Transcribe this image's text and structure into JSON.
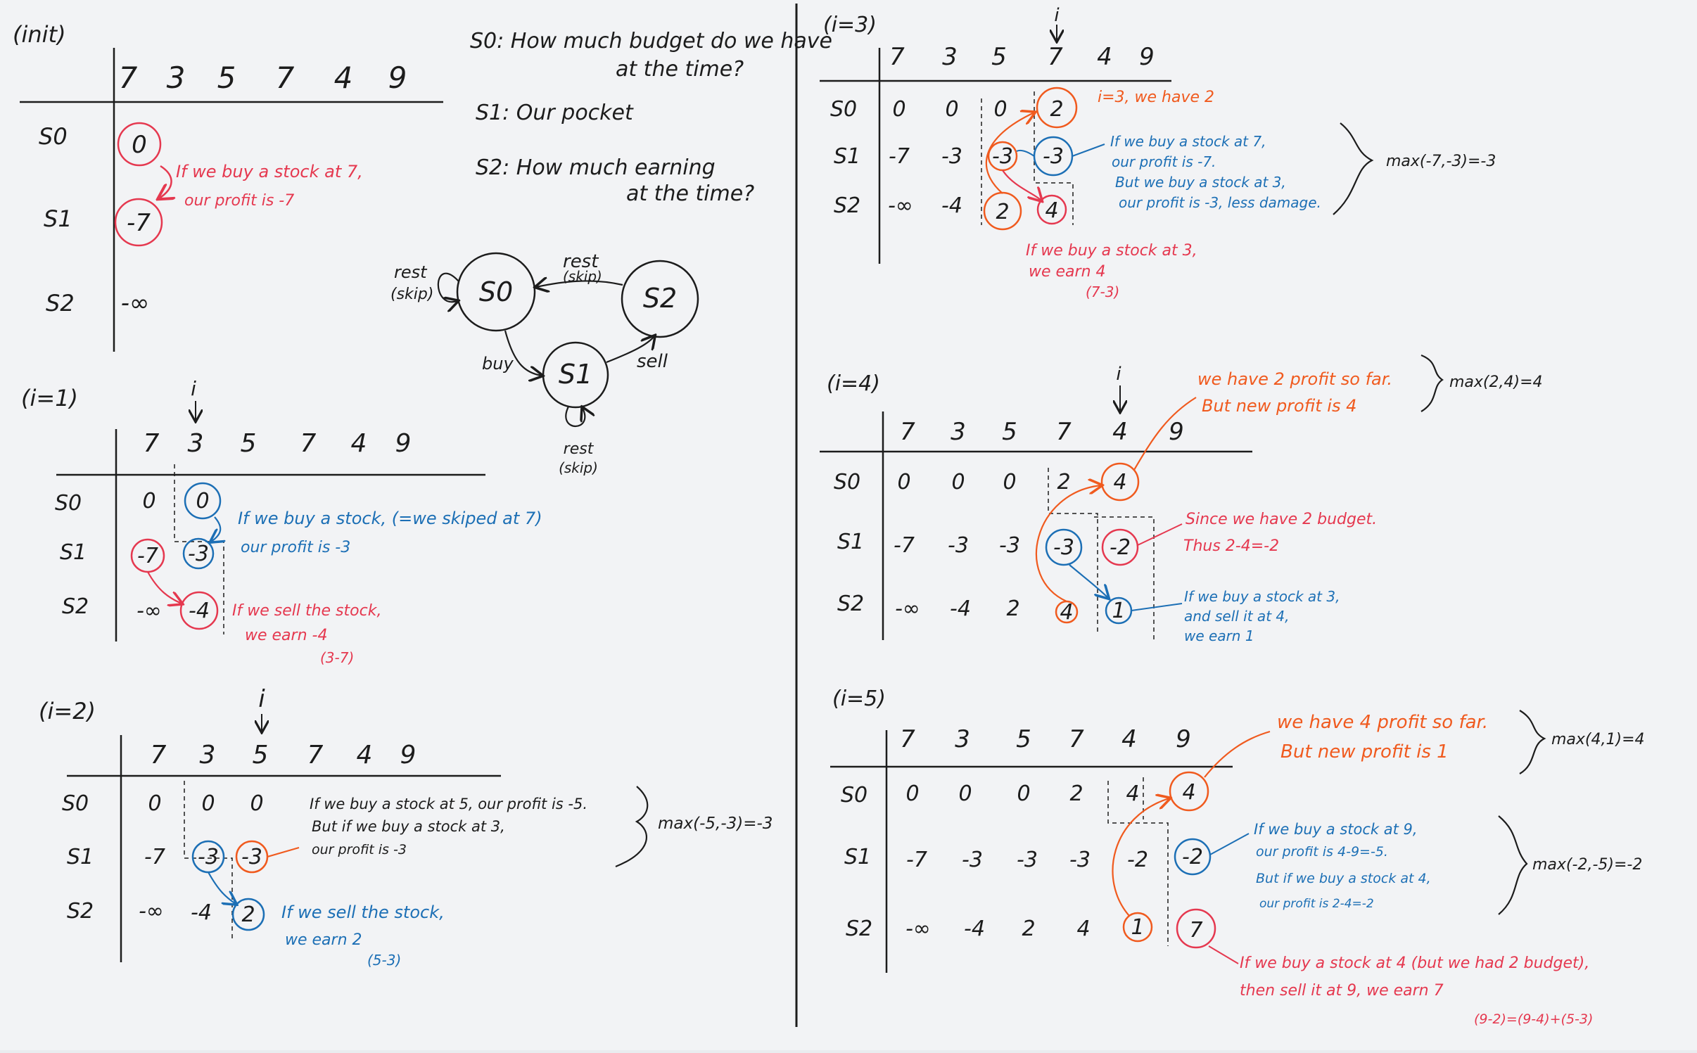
{
  "colors": {
    "ink": "#1c1c1c",
    "red": "#e5384f",
    "orange": "#f05a1e",
    "blue": "#1c6fb5",
    "board": "#f2f3f5"
  },
  "prices": [
    "7",
    "3",
    "5",
    "7",
    "4",
    "9"
  ],
  "legend": {
    "s0_line1": "S0: How much budget do we have",
    "s0_line2": "at the time?",
    "s1": "S1: Our pocket",
    "s2_line1": "S2: How much earning",
    "s2_line2": "at the time?"
  },
  "state_machine": {
    "s0": "S0",
    "s1": "S1",
    "s2": "S2",
    "rest_s0": "rest",
    "rest_s0_sub": "(skip)",
    "rest_top": "rest",
    "rest_top_sub": "(skip)",
    "rest_s1": "rest",
    "rest_s1_sub": "(skip)",
    "buy": "buy",
    "sell": "sell"
  },
  "panels": {
    "init": {
      "title": "(init)",
      "rows": [
        "S0",
        "S1",
        "S2"
      ],
      "cells": {
        "s0": "0",
        "s1": "-7",
        "s2": "-∞"
      },
      "note_l1": "If we buy a stock at 7,",
      "note_l2": "our profit is -7"
    },
    "i1": {
      "title": "(i=1)",
      "marker": "i",
      "rows": [
        "S0",
        "S1",
        "S2"
      ],
      "col0": [
        "0",
        "-7",
        "-∞"
      ],
      "col1": [
        "0",
        "-3",
        "-4"
      ],
      "blue_l1": "If we buy a stock, (=we skiped at 7)",
      "blue_l2": "our profit is -3",
      "red_l1": "If we sell the stock,",
      "red_l2": "we earn -4",
      "red_l3": "(3-7)"
    },
    "i2": {
      "title": "(i=2)",
      "marker": "i",
      "rows": [
        "S0",
        "S1",
        "S2"
      ],
      "col0": [
        "0",
        "-7",
        "-∞"
      ],
      "col1": [
        "0",
        "-3",
        "-4"
      ],
      "col2": [
        "0",
        "-3",
        "2"
      ],
      "note_l1": "If we buy a stock at 5, our profit is -5.",
      "note_l2": "But if we buy a stock at 3,",
      "note_l3": "our profit is -3",
      "max": "max(-5,-3)=-3",
      "blue_l1": "If we sell the stock,",
      "blue_l2": "we earn 2",
      "blue_l3": "(5-3)"
    },
    "i3": {
      "title": "(i=3)",
      "marker": "i",
      "rows": [
        "S0",
        "S1",
        "S2"
      ],
      "col0": [
        "0",
        "-7",
        "-∞"
      ],
      "col1": [
        "0",
        "-3",
        "-4"
      ],
      "col2": [
        "0",
        "-3",
        "2"
      ],
      "col3": [
        "2",
        "-3",
        "4"
      ],
      "orange_note": "i=3, we have 2",
      "blue_l1": "If we buy a stock at 7,",
      "blue_l2": "our profit is -7.",
      "blue_l3": "But we buy a stock at 3,",
      "blue_l4": "our profit is -3, less damage.",
      "max": "max(-7,-3)=-3",
      "red_l1": "If we buy a stock at 3,",
      "red_l2": "we earn 4",
      "red_l3": "(7-3)"
    },
    "i4": {
      "title": "(i=4)",
      "marker": "i",
      "rows": [
        "S0",
        "S1",
        "S2"
      ],
      "col0": [
        "0",
        "-7",
        "-∞"
      ],
      "col1": [
        "0",
        "-3",
        "-4"
      ],
      "col2": [
        "0",
        "-3",
        "2"
      ],
      "col3": [
        "2",
        "-3",
        "4"
      ],
      "col4": [
        "4",
        "-2",
        "1"
      ],
      "orange_l1": "we have 2 profit so far.",
      "orange_l2": "But new profit is 4",
      "max": "max(2,4)=4",
      "red_l1": "Since we have 2 budget.",
      "red_l2": "Thus 2-4=-2",
      "blue_l1": "If we buy a stock at 3,",
      "blue_l2": "and sell it at 4,",
      "blue_l3": "we earn 1"
    },
    "i5": {
      "title": "(i=5)",
      "rows": [
        "S0",
        "S1",
        "S2"
      ],
      "col0": [
        "0",
        "-7",
        "-∞"
      ],
      "col1": [
        "0",
        "-3",
        "-4"
      ],
      "col2": [
        "0",
        "-3",
        "2"
      ],
      "col3": [
        "2",
        "-3",
        "4"
      ],
      "col4": [
        "4",
        "-2",
        "1"
      ],
      "col5": [
        "4",
        "-2",
        "7"
      ],
      "orange_l1": "we have 4 profit so far.",
      "orange_l2": "But new profit is 1",
      "max_top": "max(4,1)=4",
      "blue_l1": "If we buy a stock at 9,",
      "blue_l2": "our profit is 4-9=-5.",
      "blue_l3": "But if we buy a stock at 4,",
      "blue_l4": "our profit is 2-4=-2",
      "max_mid": "max(-2,-5)=-2",
      "red_l1": "If we buy a stock at 4 (but we had 2 budget),",
      "red_l2": "then sell it at 9, we earn 7",
      "red_l3": "(9-2)=(9-4)+(5-3)"
    }
  }
}
